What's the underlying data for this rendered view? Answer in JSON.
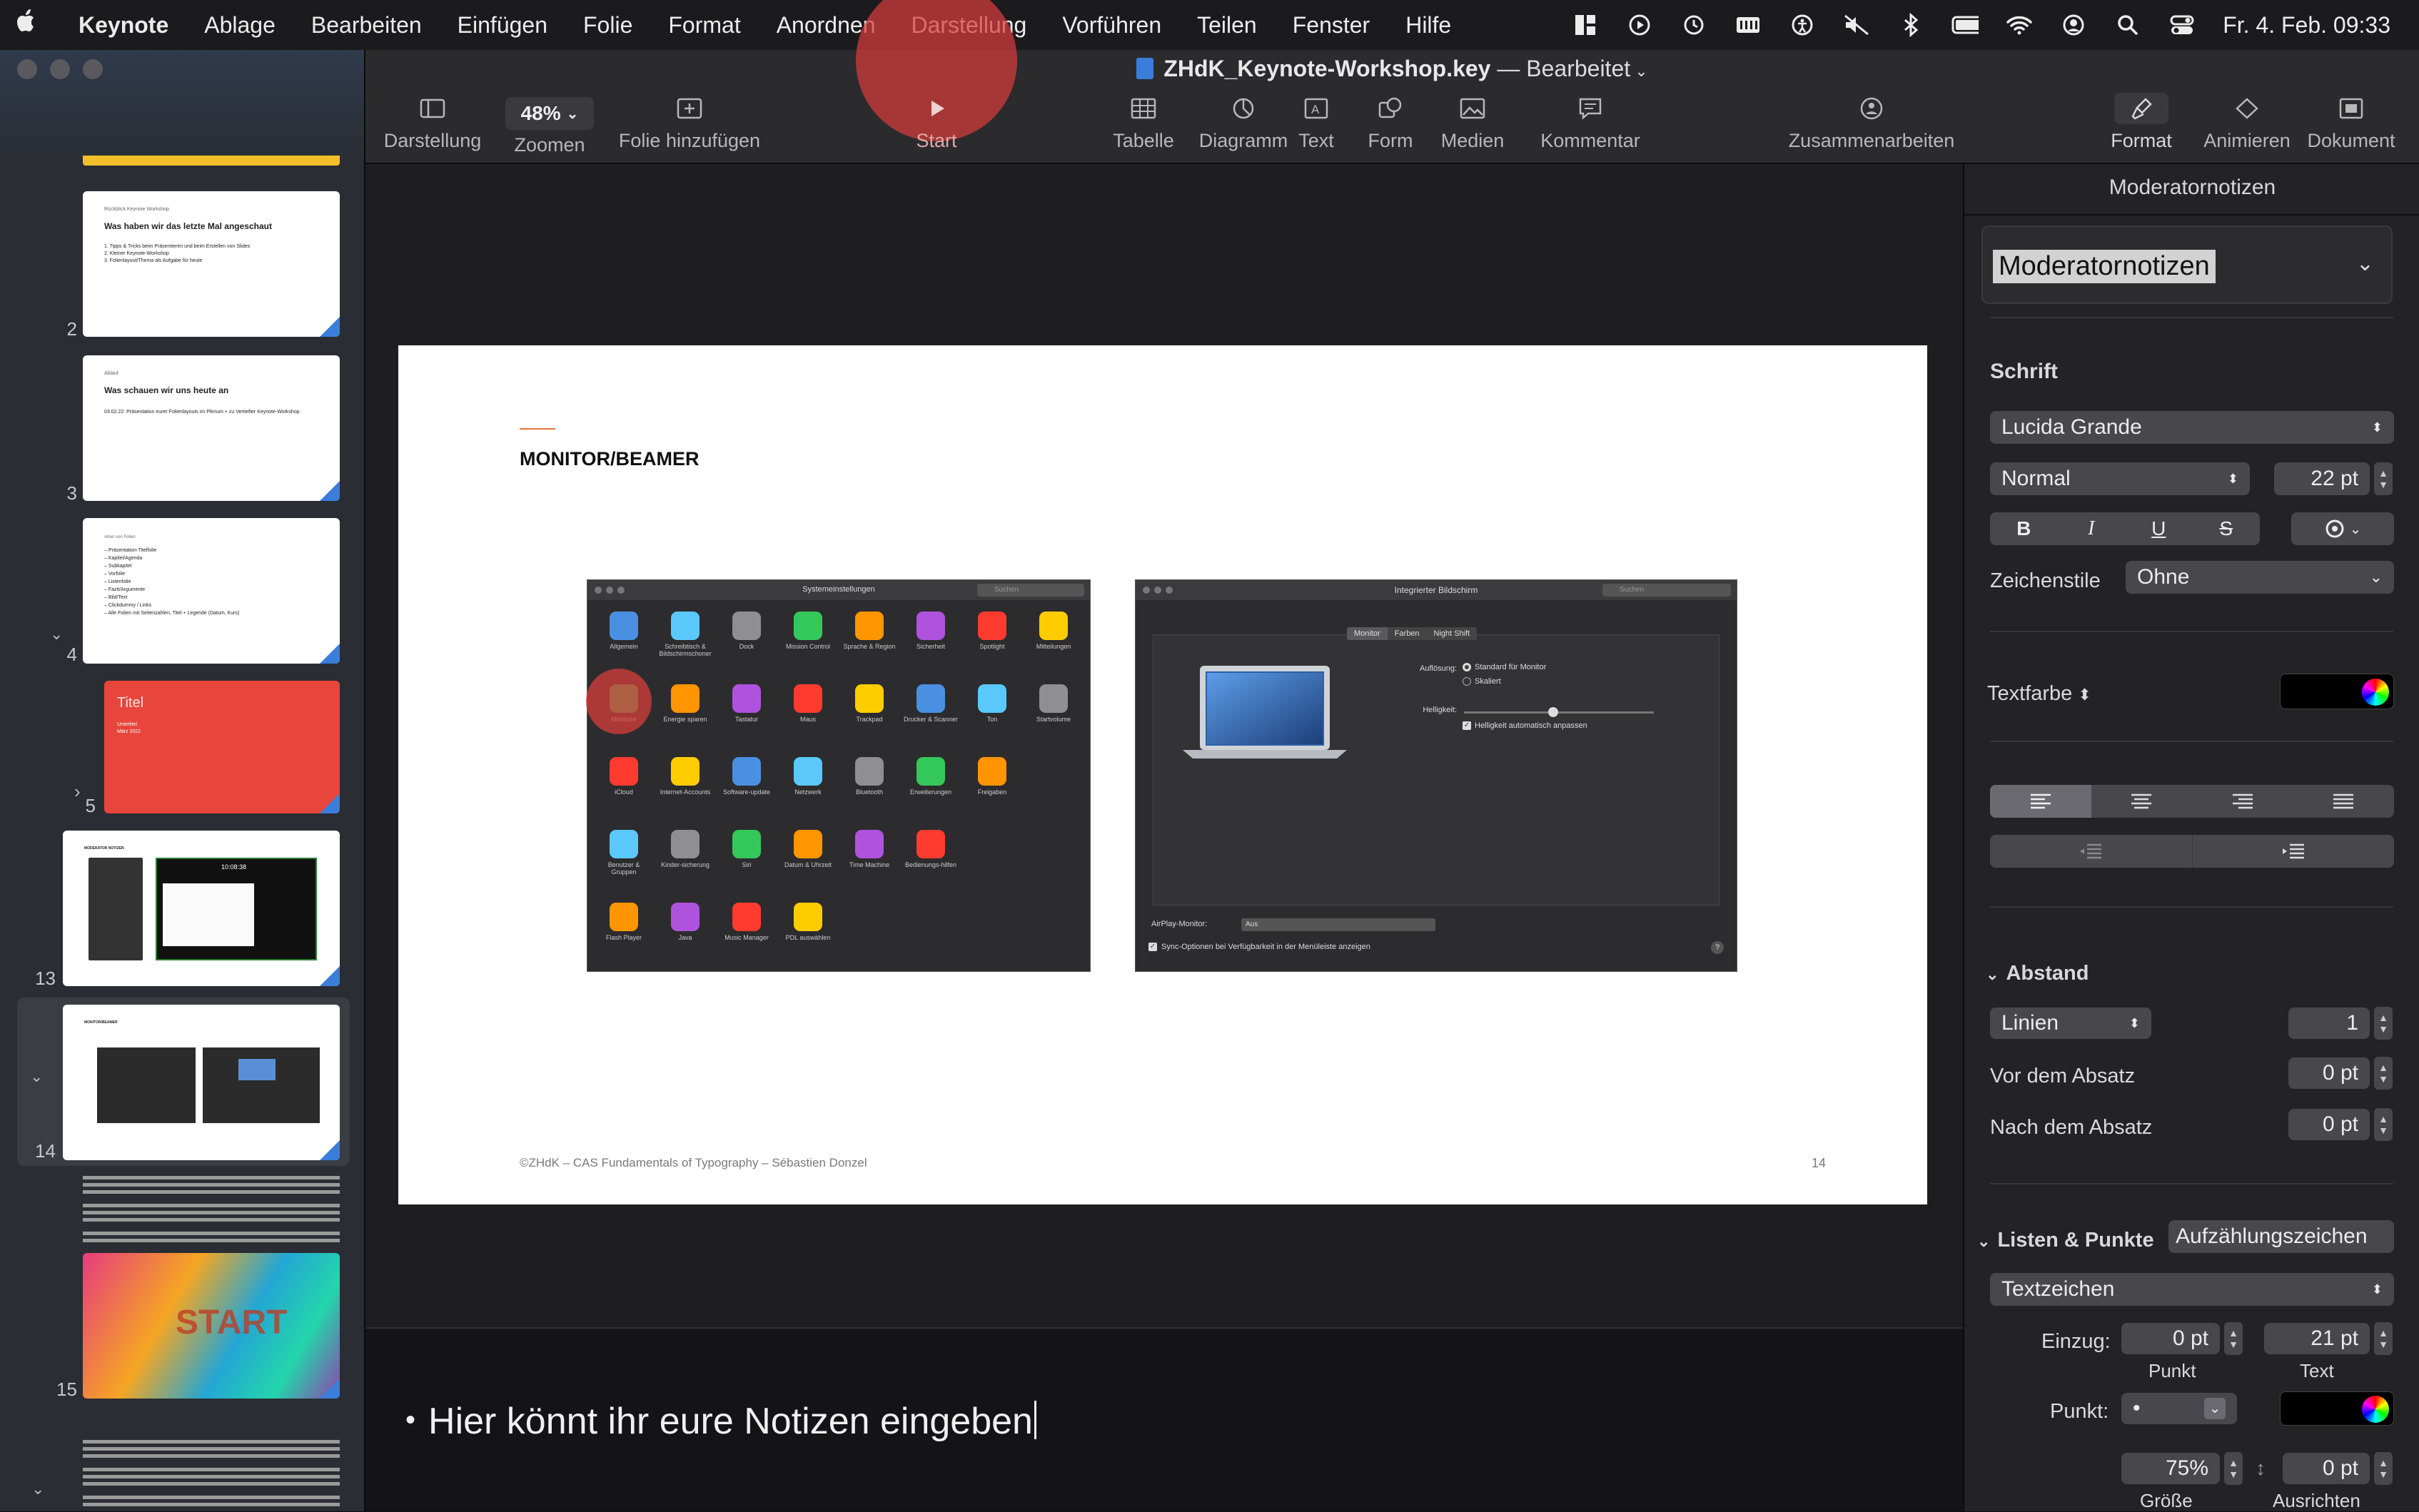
{
  "menubar": {
    "app": "Keynote",
    "items": [
      "Ablage",
      "Bearbeiten",
      "Einfügen",
      "Folie",
      "Format",
      "Anordnen",
      "Darstellung",
      "Vorführen",
      "Teilen",
      "Fenster",
      "Hilfe"
    ],
    "clock": "Fr. 4. Feb. 09:33"
  },
  "window": {
    "title": "ZHdK_Keynote-Workshop.key",
    "status": "Bearbeitet"
  },
  "toolbar": {
    "view": "Darstellung",
    "zoom_value": "48%",
    "zoom": "Zoomen",
    "add_slide": "Folie hinzufügen",
    "play": "Start",
    "table": "Tabelle",
    "chart": "Diagramm",
    "text": "Text",
    "shape": "Form",
    "media": "Medien",
    "comment": "Kommentar",
    "collaborate": "Zusammenarbeiten",
    "format": "Format",
    "animate": "Animieren",
    "document": "Dokument"
  },
  "navigator": {
    "slides": [
      {
        "num": "2",
        "heading": "Was haben wir das letzte Mal angeschaut",
        "kicker": "Rückblick Keynote Workshop",
        "lines": [
          "1. Tipps & Tricks beim Präsentieren und beim Erstellen von Slides",
          "2. Kleiner Keynote-Workshop",
          "3. Folienlayout/Thema als Aufgabe für heute"
        ]
      },
      {
        "num": "3",
        "heading": "Was schauen wir uns heute an",
        "kicker": "Ablauf",
        "lines": [
          "03.02.22: Präsentation eurer Folienlayouts im Plenum + zu Vertiefter Keynote-Workshop"
        ]
      },
      {
        "num": "4",
        "heading": "",
        "kicker": "Arten von Folien",
        "lines": [
          "– Präsentation-Titelfolie",
          "– Kapitel/Agenda",
          "– Subkapitel",
          "– Vorfolie",
          "– Listenfolie",
          "– Fazit/Argumente",
          "– Bild/Text",
          "– Clickdummy / Links",
          "– Alle Folien mit Seitenzahlen, Titel + Legende (Datum, Kurs)"
        ]
      },
      {
        "num": "5",
        "heading": "Titel",
        "kicker": "Untertitel",
        "lines": [
          "März 2022"
        ]
      },
      {
        "num": "13",
        "heading": "",
        "kicker": "MODERATOR NOTIZEN",
        "lines": [
          "10:08:38"
        ]
      },
      {
        "num": "14",
        "heading": "",
        "kicker": "MONITOR/BEAMER",
        "lines": []
      },
      {
        "num": "15",
        "heading": "",
        "kicker": "",
        "lines": [
          "START"
        ]
      }
    ]
  },
  "slide": {
    "title": "MONITOR/BEAMER",
    "footer": "©ZHdK – CAS Fundamentals of Typography – Sébastien Donzel",
    "page": "14",
    "syspref": {
      "title": "Systemeinstellungen",
      "search": "Suchen",
      "rows": [
        [
          "Allgemein",
          "Schreibtisch & Bildschirmschoner",
          "Dock",
          "Mission Control",
          "Sprache & Region",
          "Sicherheit",
          "Spotlight",
          "Mitteilungen"
        ],
        [
          "Monitore",
          "Energie sparen",
          "Tastatur",
          "Maus",
          "Trackpad",
          "Drucker & Scanner",
          "Ton",
          "Startvolume"
        ],
        [
          "iCloud",
          "Internet-Accounts",
          "Software-update",
          "Netzwerk",
          "Bluetooth",
          "Erweiterungen",
          "Freigaben"
        ],
        [
          "Benutzer & Gruppen",
          "Kinder-sicherung",
          "Siri",
          "Datum & Uhrzeit",
          "Time Machine",
          "Bedienungs-hilfen"
        ],
        [
          "Flash Player",
          "Java",
          "Music Manager",
          "PDL auswählen"
        ]
      ]
    },
    "display": {
      "title": "Integrierter Bildschirm",
      "search": "Suchen",
      "tabs": [
        "Monitor",
        "Farben",
        "Night Shift"
      ],
      "resolution_label": "Auflösung:",
      "res_options": [
        "Standard für Monitor",
        "Skaliert"
      ],
      "brightness_label": "Helligkeit:",
      "auto_brightness": "Helligkeit automatisch anpassen",
      "airplay_label": "AirPlay-Monitor:",
      "airplay_value": "Aus",
      "sync_option": "Sync-Optionen bei Verfügbarkeit in der Menüleiste anzeigen"
    }
  },
  "notes": {
    "text": "Hier könnt ihr eure Notizen eingeben"
  },
  "inspector": {
    "header": "Moderatornotizen",
    "style": "Moderatornotizen",
    "font_section": "Schrift",
    "font_family": "Lucida Grande",
    "font_weight": "Normal",
    "font_size": "22 pt",
    "bold": "B",
    "italic": "I",
    "underline": "U",
    "strike": "S",
    "char_styles_label": "Zeichenstile",
    "char_styles_value": "Ohne",
    "text_color_label": "Textfarbe",
    "spacing_section": "Abstand",
    "spacing_mode": "Linien",
    "spacing_value": "1",
    "before_label": "Vor dem Absatz",
    "before_value": "0 pt",
    "after_label": "Nach dem Absatz",
    "after_value": "0 pt",
    "lists_section": "Listen & Punkte",
    "lists_value": "Aufzählungszeichen",
    "bullet_type": "Textzeichen",
    "indent_label": "Einzug:",
    "indent_point": "0 pt",
    "indent_text": "21 pt",
    "caption_point": "Punkt",
    "caption_text": "Text",
    "bullet_label": "Punkt:",
    "bullet_char": "•",
    "size_value": "75%",
    "align_value": "0 pt",
    "caption_size": "Größe",
    "caption_align": "Ausrichten"
  },
  "colors": {
    "accent": "#3b7ddb",
    "highlight": "#d73c3c",
    "slide_red": "#e8453c"
  }
}
